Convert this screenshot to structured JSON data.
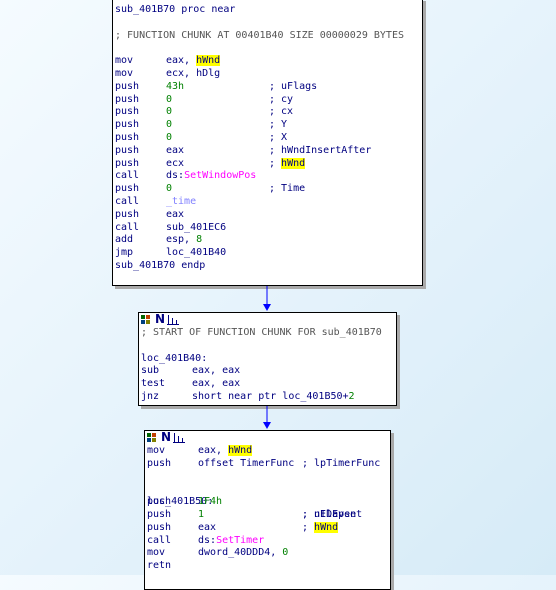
{
  "block1": {
    "proc_start": "sub_401B70 proc near",
    "chunk_note": "; FUNCTION CHUNK AT 00401B40 SIZE 00000029 BYTES",
    "proc_end": "sub_401B70 endp",
    "lines": [
      {
        "mn": "mov",
        "a": "eax, ",
        "b": "hWnd",
        "bhl": true,
        "c": "",
        "chl": false
      },
      {
        "mn": "mov",
        "a": "ecx, hDlg",
        "b": "",
        "c": ""
      },
      {
        "mn": "push",
        "a": "",
        "num": "43h",
        "c": "; uFlags"
      },
      {
        "mn": "push",
        "a": "",
        "num": "0",
        "c": "; cy"
      },
      {
        "mn": "push",
        "a": "",
        "num": "0",
        "c": "; cx"
      },
      {
        "mn": "push",
        "a": "",
        "num": "0",
        "c": "; Y"
      },
      {
        "mn": "push",
        "a": "",
        "num": "0",
        "c": "; X"
      },
      {
        "mn": "push",
        "a": "eax",
        "c": "; hWndInsertAfter"
      },
      {
        "mn": "push",
        "a": "ecx",
        "c": "; ",
        "chlw": "hWnd"
      },
      {
        "mn": "call",
        "a": "ds:",
        "fn": "SetWindowPos",
        "c": ""
      },
      {
        "mn": "push",
        "a": "",
        "num": "0",
        "c": "; Time"
      },
      {
        "mn": "call",
        "a": "",
        "lib": "_time",
        "c": ""
      },
      {
        "mn": "push",
        "a": "eax",
        "c": ""
      },
      {
        "mn": "call",
        "a": "sub_401EC6",
        "c": ""
      },
      {
        "mn": "add",
        "a": "esp, ",
        "num": "8",
        "c": ""
      },
      {
        "mn": "jmp",
        "a": "loc_401B40",
        "c": ""
      }
    ]
  },
  "block2": {
    "header_n": "N",
    "chunk_note": "; START OF FUNCTION CHUNK FOR sub_401B70",
    "label": "loc_401B40:",
    "lines": [
      {
        "mn": "sub",
        "a": "eax, eax"
      },
      {
        "mn": "test",
        "a": "eax, eax"
      },
      {
        "mn": "jnz",
        "a": "short near ptr loc_401B50+",
        "num": "2"
      }
    ]
  },
  "block3": {
    "header_n": "N",
    "lines1": [
      {
        "mn": "mov",
        "a": "eax, ",
        "b": "hWnd",
        "c": ""
      },
      {
        "mn": "push",
        "a": "offset TimerFunc",
        "c": "; lpTimerFunc"
      }
    ],
    "label": "loc_401B50:",
    "label_comment": "; uElapse",
    "lines2": [
      {
        "mn": "push",
        "num": "1F4h",
        "c": ""
      },
      {
        "mn": "push",
        "num": "1",
        "c": "; nIDEvent"
      },
      {
        "mn": "push",
        "a": "eax",
        "c": "; ",
        "chlw": "hWnd"
      },
      {
        "mn": "call",
        "a": "ds:",
        "fn": "SetTimer",
        "c": ""
      },
      {
        "mn": "mov",
        "a": "dword_40DDD4, ",
        "num": "0",
        "c": ""
      },
      {
        "mn": "retn",
        "a": "",
        "c": ""
      }
    ]
  },
  "colors": {
    "edge": "#0000ff",
    "highlight": "#ffff00",
    "func": "#ff00ff",
    "number": "#008000",
    "text": "#000080"
  }
}
